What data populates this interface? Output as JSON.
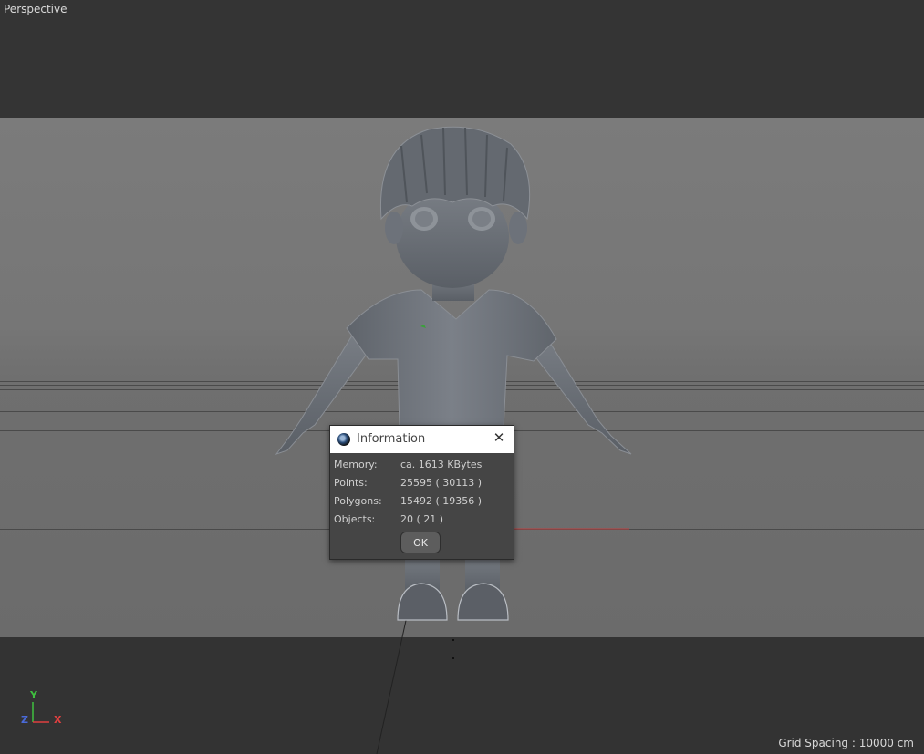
{
  "viewport": {
    "label": "Perspective",
    "grid_spacing": "Grid Spacing : 10000 cm",
    "axes": {
      "y": "Y",
      "z": "Z",
      "x": "X"
    }
  },
  "dialog": {
    "title": "Information",
    "close_icon": "close-icon",
    "rows": [
      {
        "label": "Memory:",
        "value": "ca. 1613 KBytes"
      },
      {
        "label": "Points:",
        "value": "25595 ( 30113 )"
      },
      {
        "label": "Polygons:",
        "value": "15492 ( 19356 )"
      },
      {
        "label": "Objects:",
        "value": "20 ( 21 )"
      }
    ],
    "ok_label": "OK"
  },
  "colors": {
    "axis_x": "#e04040",
    "axis_y": "#3fbf3f",
    "axis_z": "#4a6ad8"
  }
}
